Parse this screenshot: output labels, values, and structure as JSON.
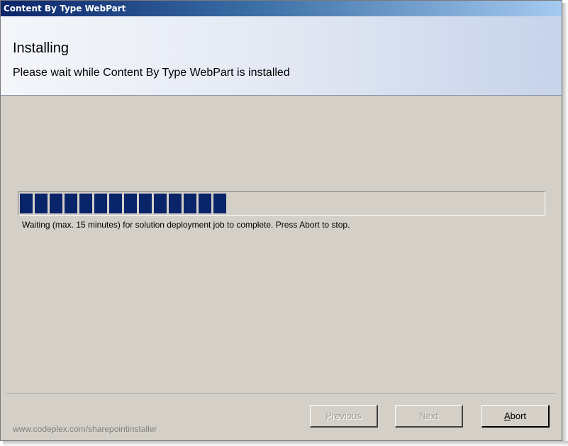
{
  "window": {
    "title": "Content By Type WebPart"
  },
  "header": {
    "title": "Installing",
    "subtitle": "Please wait while Content By Type WebPart is installed"
  },
  "progress": {
    "value_fraction": 0.4,
    "chunks_filled": 14
  },
  "status_text": "Waiting (max. 15 minutes) for solution deployment job to complete. Press Abort to stop.",
  "footer": {
    "link": "www.codeplex.com/sharepointinstaller"
  },
  "buttons": {
    "previous": {
      "label": "Previous",
      "mnemonic": "P",
      "enabled": false
    },
    "next": {
      "label": "Next",
      "mnemonic": "N",
      "enabled": false
    },
    "abort": {
      "label": "Abort",
      "mnemonic": "A",
      "enabled": true
    }
  },
  "colors": {
    "titlebar_start": "#0a246a",
    "titlebar_end": "#a6caf0",
    "progress_fill": "#0a246a",
    "dialog_bg": "#d4d0c8"
  }
}
